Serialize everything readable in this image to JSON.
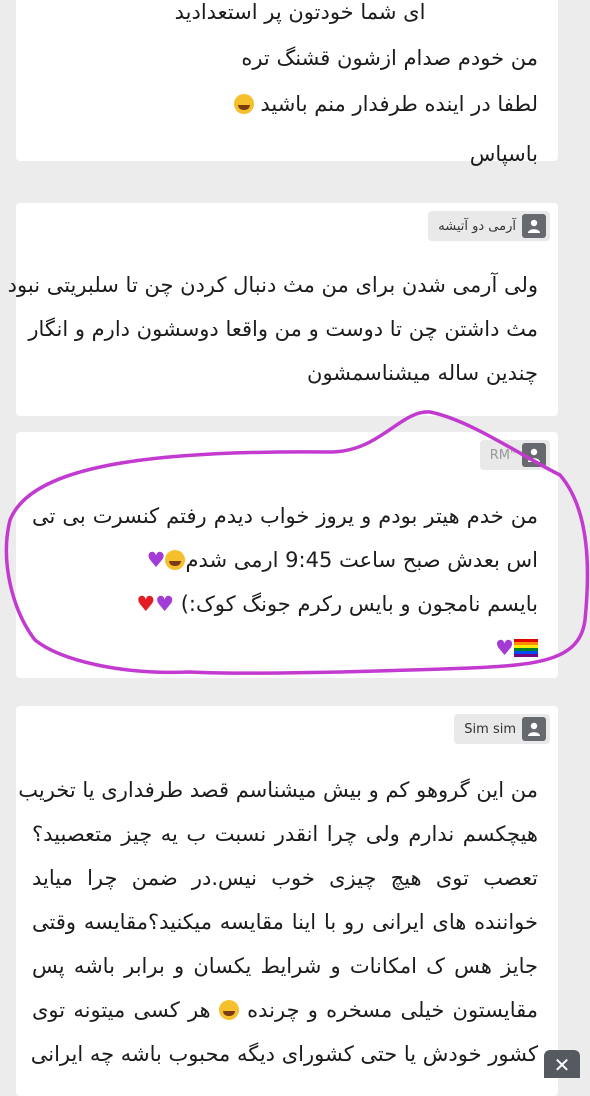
{
  "comments": [
    {
      "author": "",
      "lines": [
        "ای شما خودتون پر استعدادید",
        "من خودم صدام ازشون قشنگ تره",
        "لطفا در اینده طرفدار منم باشید",
        "باسپاس"
      ],
      "emoji_after_line_3": "laughing-emoji"
    },
    {
      "author": "آرمی دو آتیشه",
      "lines": [
        "ولی آرمی شدن برای من مث دنبال کردن چن تا سلبریتی نبود",
        "مث داشتن چن تا دوست و من واقعا دوسشون دارم و انگار",
        "چندین ساله میشناسمشون"
      ]
    },
    {
      "author": "RM\"",
      "lines": [
        "من خدم هیتر بودم و یروز خواب دیدم رفتم کنسرت بی تی",
        "اس بعدش صبح ساعت 9:45 ارمی شدم",
        "بایسم نامجون و بایس رکرم جونگ کوک:)"
      ],
      "emojis": [
        "laughing-emoji",
        "purple-heart",
        "purple-heart",
        "red-heart",
        "purple-heart",
        "rainbow-flag"
      ]
    },
    {
      "author": "Sim sim",
      "lines": [
        "من این گروهو کم و بیش میشناسم قصد طرفداری یا تخریب",
        "هیچکسم ندارم ولی چرا انقدر نسبت ب یه چیز متعصبید؟",
        "تعصب توی هیچ چیزی خوب نیس.در ضمن چرا میاید",
        "خواننده های ایرانی رو با اینا مقایسه میکنید؟مقایسه وقتی",
        "جایز هس ک امکانات و شرایط یکسان و برابر باشه پس",
        "مقایستون خیلی مسخره و چرنده",
        "هر کسی میتونه توی",
        "کشور خودش یا حتی کشورای دیگه محبوب باشه چه ایرانی"
      ],
      "emojis": [
        "rolling-laughing-emoji"
      ]
    }
  ],
  "close_button": {
    "label": "✕"
  },
  "colors": {
    "page_bg": "#ececec",
    "card_bg": "#ffffff",
    "chip_bg": "#e9e9e9",
    "highlight_circle": "#c23ad0"
  }
}
